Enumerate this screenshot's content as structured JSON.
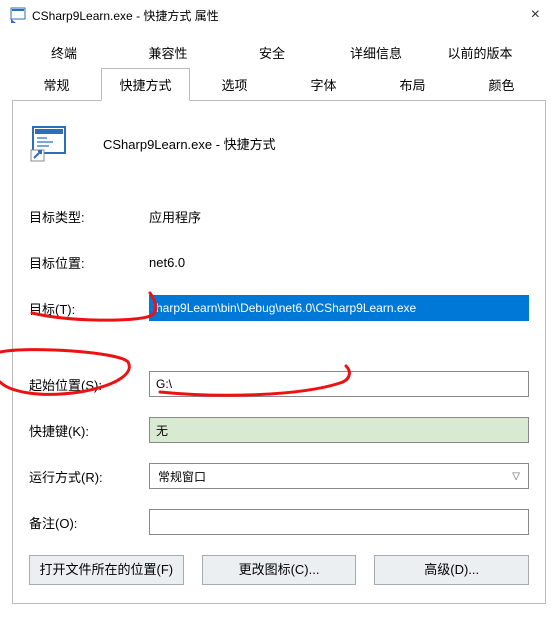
{
  "window": {
    "title": "CSharp9Learn.exe - 快捷方式 属性",
    "close": "×"
  },
  "tabs": {
    "upper": [
      "终端",
      "兼容性",
      "安全",
      "详细信息",
      "以前的版本"
    ],
    "lower": [
      "常规",
      "快捷方式",
      "选项",
      "字体",
      "布局",
      "颜色"
    ]
  },
  "header": {
    "name": "CSharp9Learn.exe - 快捷方式"
  },
  "fields": {
    "target_type": {
      "label": "目标类型:",
      "value": "应用程序"
    },
    "target_location": {
      "label": "目标位置:",
      "value": "net6.0"
    },
    "target": {
      "label": "目标(T):",
      "value": "harp9Learn\\bin\\Debug\\net6.0\\CSharp9Learn.exe"
    },
    "start_in": {
      "label": "起始位置(S):",
      "value": "G:\\"
    },
    "shortcut_key": {
      "label": "快捷键(K):",
      "value": "无"
    },
    "run": {
      "label": "运行方式(R):",
      "value": "常规窗口"
    },
    "comment": {
      "label": "备注(O):",
      "value": ""
    }
  },
  "buttons": {
    "open_location": "打开文件所在的位置(F)",
    "change_icon": "更改图标(C)...",
    "advanced": "高级(D)..."
  }
}
